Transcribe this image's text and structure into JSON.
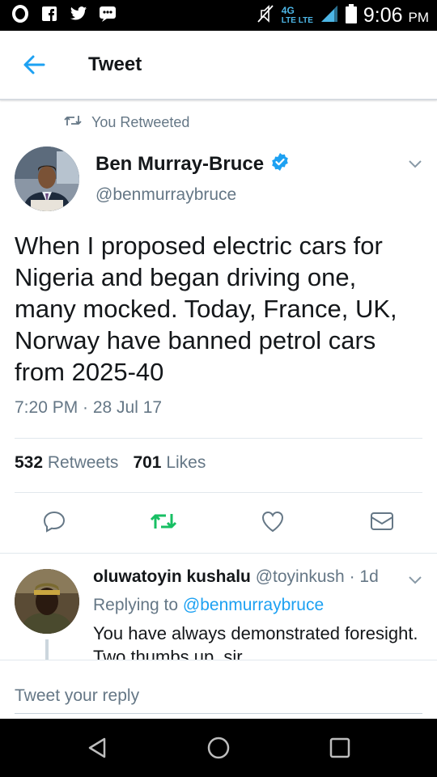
{
  "status_bar": {
    "network": "4G",
    "network_sub": "LTE LTE",
    "time": "9:06",
    "ampm": "PM",
    "icons": [
      "opera-icon",
      "facebook-icon",
      "twitter-icon",
      "bbm-icon",
      "mute-icon",
      "signal-icon",
      "battery-icon"
    ]
  },
  "app_bar": {
    "title": "Tweet"
  },
  "tweet": {
    "retweeted_label": "You Retweeted",
    "author_name": "Ben Murray-Bruce",
    "author_handle": "@benmurraybruce",
    "verified": true,
    "text": "When I proposed electric cars for Nigeria and began driving one, many mocked. Today, France, UK, Norway have banned petrol cars from 2025-40",
    "timestamp": "7:20 PM · 28 Jul 17",
    "retweets_count": "532",
    "retweets_label": "Retweets",
    "likes_count": "701",
    "likes_label": "Likes",
    "retweeted_color": "#17bf63"
  },
  "reply": {
    "name": "oluwatoyin kushalu",
    "meta": "@toyinkush · 1d",
    "replying_prefix": "Replying to",
    "replying_handle": "@benmurraybruce",
    "text": "You have always demonstrated foresight. Two thumbs up, sir."
  },
  "composer": {
    "placeholder": "Tweet your reply"
  },
  "colors": {
    "accent": "#1da1f2",
    "secondary_text": "#657786",
    "retweet_green": "#17bf63"
  }
}
